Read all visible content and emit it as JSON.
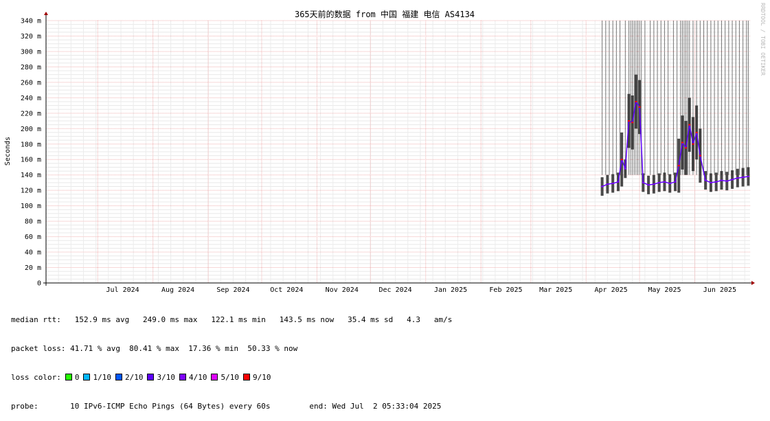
{
  "chart_data": {
    "type": "line",
    "title": "365天前的数据 from 中国 福建 电信 AS4134",
    "ylabel": "Seconds",
    "watermark": "RRDTOOL / TOBI OETIKER",
    "ylim": [
      0,
      0.34
    ],
    "y_ticks": [
      {
        "value": 0,
        "label": "0"
      },
      {
        "value": 0.02,
        "label": "20 m"
      },
      {
        "value": 0.04,
        "label": "40 m"
      },
      {
        "value": 0.06,
        "label": "60 m"
      },
      {
        "value": 0.08,
        "label": "80 m"
      },
      {
        "value": 0.1,
        "label": "100 m"
      },
      {
        "value": 0.12,
        "label": "120 m"
      },
      {
        "value": 0.14,
        "label": "140 m"
      },
      {
        "value": 0.16,
        "label": "160 m"
      },
      {
        "value": 0.18,
        "label": "180 m"
      },
      {
        "value": 0.2,
        "label": "200 m"
      },
      {
        "value": 0.22,
        "label": "220 m"
      },
      {
        "value": 0.24,
        "label": "240 m"
      },
      {
        "value": 0.26,
        "label": "260 m"
      },
      {
        "value": 0.28,
        "label": "280 m"
      },
      {
        "value": 0.3,
        "label": "300 m"
      },
      {
        "value": 0.32,
        "label": "320 m"
      },
      {
        "value": 0.34,
        "label": "340 m"
      }
    ],
    "x_range": [
      "2024-06-02",
      "2025-07-02"
    ],
    "x_ticks": [
      {
        "date": "2024-07-15",
        "label": "Jul 2024"
      },
      {
        "date": "2024-08-15",
        "label": "Aug 2024"
      },
      {
        "date": "2024-09-15",
        "label": "Sep 2024"
      },
      {
        "date": "2024-10-15",
        "label": "Oct 2024"
      },
      {
        "date": "2024-11-15",
        "label": "Nov 2024"
      },
      {
        "date": "2024-12-15",
        "label": "Dec 2024"
      },
      {
        "date": "2025-01-15",
        "label": "Jan 2025"
      },
      {
        "date": "2025-02-15",
        "label": "Feb 2025"
      },
      {
        "date": "2025-03-15",
        "label": "Mar 2025"
      },
      {
        "date": "2025-04-15",
        "label": "Apr 2025"
      },
      {
        "date": "2025-05-15",
        "label": "May 2025"
      },
      {
        "date": "2025-06-15",
        "label": "Jun 2025"
      }
    ],
    "grid": true,
    "series": [
      {
        "name": "median rtt",
        "x": [
          "2025-04-10",
          "2025-04-13",
          "2025-04-16",
          "2025-04-19",
          "2025-04-21",
          "2025-04-23",
          "2025-04-25",
          "2025-04-27",
          "2025-04-29",
          "2025-05-01",
          "2025-05-03",
          "2025-05-06",
          "2025-05-09",
          "2025-05-12",
          "2025-05-15",
          "2025-05-18",
          "2025-05-21",
          "2025-05-23",
          "2025-05-25",
          "2025-05-27",
          "2025-05-29",
          "2025-05-31",
          "2025-06-02",
          "2025-06-04",
          "2025-06-07",
          "2025-06-10",
          "2025-06-13",
          "2025-06-16",
          "2025-06-19",
          "2025-06-22",
          "2025-06-25",
          "2025-06-28",
          "2025-07-01"
        ],
        "values": [
          0.125,
          0.128,
          0.129,
          0.131,
          0.16,
          0.148,
          0.21,
          0.208,
          0.235,
          0.228,
          0.13,
          0.127,
          0.128,
          0.13,
          0.131,
          0.129,
          0.131,
          0.152,
          0.182,
          0.175,
          0.205,
          0.18,
          0.195,
          0.165,
          0.133,
          0.13,
          0.131,
          0.133,
          0.132,
          0.134,
          0.136,
          0.137,
          0.138
        ]
      }
    ],
    "loss_outages": [
      "2025-04-10",
      "2025-04-12",
      "2025-04-14",
      "2025-04-16",
      "2025-04-18",
      "2025-04-20",
      "2025-04-23",
      "2025-04-25",
      "2025-04-26",
      "2025-04-27",
      "2025-04-28",
      "2025-04-29",
      "2025-04-30",
      "2025-05-01",
      "2025-05-02",
      "2025-05-04",
      "2025-05-07",
      "2025-05-09",
      "2025-05-11",
      "2025-05-13",
      "2025-05-15",
      "2025-05-17",
      "2025-05-20",
      "2025-05-22",
      "2025-05-24",
      "2025-05-25",
      "2025-05-26",
      "2025-05-27",
      "2025-05-28",
      "2025-05-29",
      "2025-05-31",
      "2025-06-02",
      "2025-06-04",
      "2025-06-06",
      "2025-06-08",
      "2025-06-10",
      "2025-06-12",
      "2025-06-14",
      "2025-06-16",
      "2025-06-18",
      "2025-06-20",
      "2025-06-22",
      "2025-06-24",
      "2025-06-26",
      "2025-06-28",
      "2025-06-30",
      "2025-07-01"
    ]
  },
  "legend": {
    "median_rtt": "median rtt:   152.9 ms avg   249.0 ms max   122.1 ms min   143.5 ms now   35.4 ms sd   4.3   am/s",
    "packet_loss": "packet loss: 41.71 % avg  80.41 % max  17.36 % min  50.33 % now",
    "loss_color_label": "loss color:",
    "loss_colors": [
      {
        "label": "0",
        "color": "#26ff00"
      },
      {
        "label": "1/10",
        "color": "#00b8ff"
      },
      {
        "label": "2/10",
        "color": "#0059ff"
      },
      {
        "label": "3/10",
        "color": "#5e00ff"
      },
      {
        "label": "4/10",
        "color": "#7e00ff"
      },
      {
        "label": "5/10",
        "color": "#dd00ff"
      },
      {
        "label": "9/10",
        "color": "#ff0000"
      }
    ],
    "probe": "probe:       10 IPv6-ICMP Echo Pings (64 Bytes) every 60s",
    "end": "end: Wed Jul  2 05:33:04 2025"
  }
}
